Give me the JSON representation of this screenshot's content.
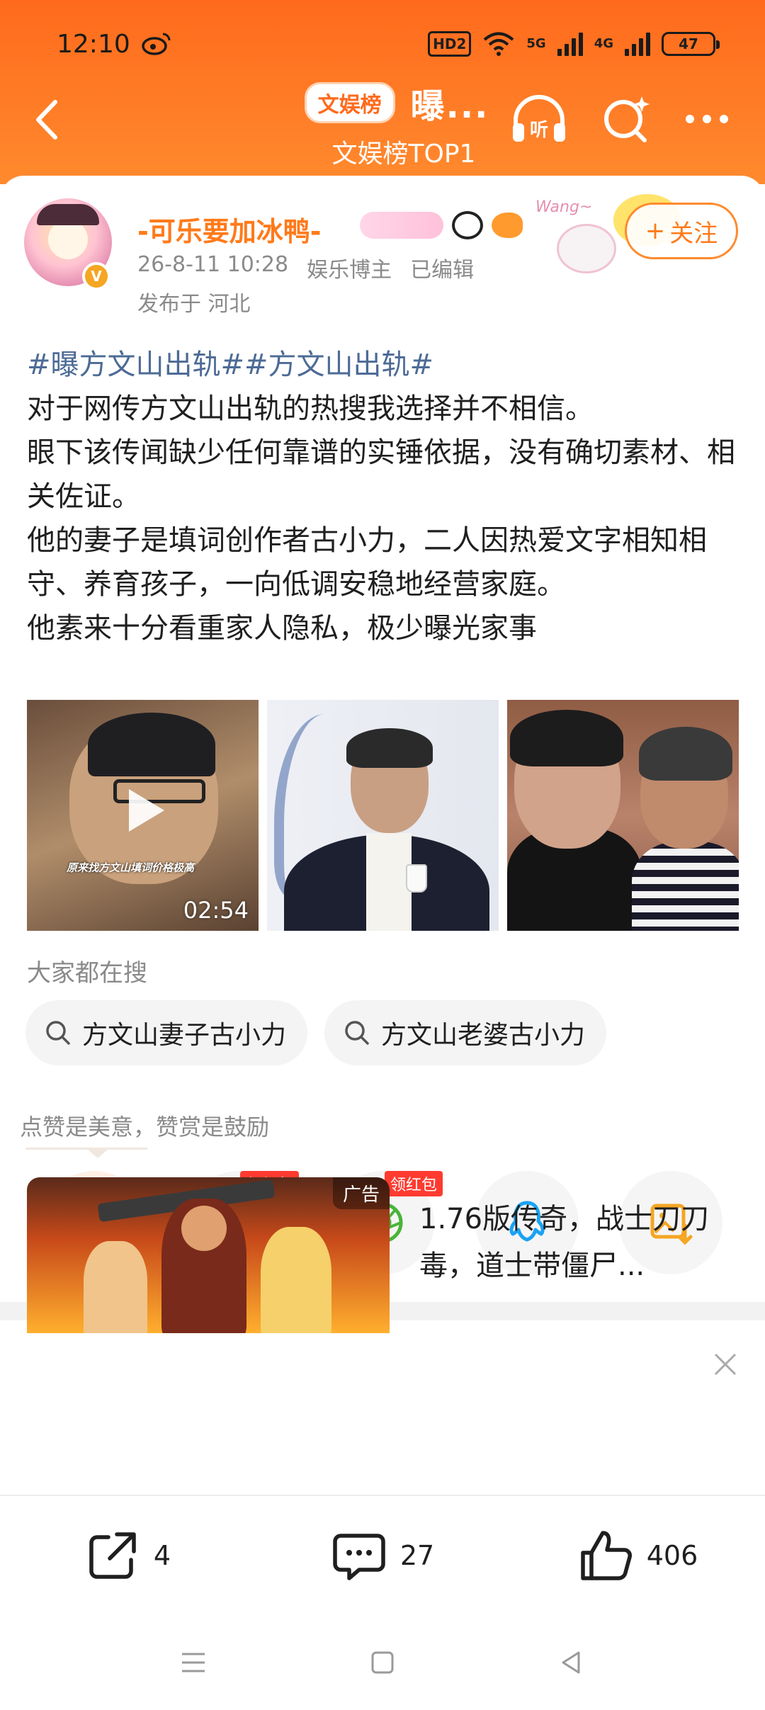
{
  "status_bar": {
    "time": "12:10",
    "hd_label": "HD2",
    "net1_label": "5G",
    "net2_label": "4G",
    "battery": "47"
  },
  "header": {
    "rank_badge": "文娱榜",
    "title": "曝...",
    "subtitle": "文娱榜TOP1",
    "accent_color": "#ff7a1a"
  },
  "post": {
    "author_name": "-可乐要加冰鸭-",
    "verified_mark": "V",
    "decor_text": "Wang~",
    "follow_label": "关注",
    "follow_plus": "+",
    "date": "26-8-11 10:28",
    "author_tag": "娱乐博主",
    "edited_label": "已编辑",
    "location": "发布于 河北",
    "hashtags": "#曝方文山出轨##方文山出轨#",
    "paragraphs": [
      "对于网传方文山出轨的热搜我选择并不相信。",
      "眼下该传闻缺少任何靠谱的实锤依据，没有确切素材、相关佐证。",
      "他的妻子是填词创作者古小力，二人因热爱文字相知相守、养育孩子，一向低调安稳地经营家庭。",
      "他素来十分看重家人隐私，极少曝光家事"
    ],
    "video_caption": "原来找方文山填词价格极高",
    "video_duration": "02:54"
  },
  "searches": {
    "title": "大家都在搜",
    "items": [
      "方文山妻子古小力",
      "方文山老婆古小力"
    ]
  },
  "reward": {
    "hint": "点赞是美意，赞赏是鼓励",
    "red_packet_label": "领红包",
    "share_targets": [
      "v-plus-icon",
      "wechat-icon",
      "moments-icon",
      "qq-icon",
      "save-image-icon"
    ]
  },
  "ad": {
    "label": "广告",
    "text": "1.76版传奇，战士刀刀毒，道士带僵尸..."
  },
  "actions": {
    "repost_count": "4",
    "comment_count": "27",
    "like_count": "406"
  }
}
